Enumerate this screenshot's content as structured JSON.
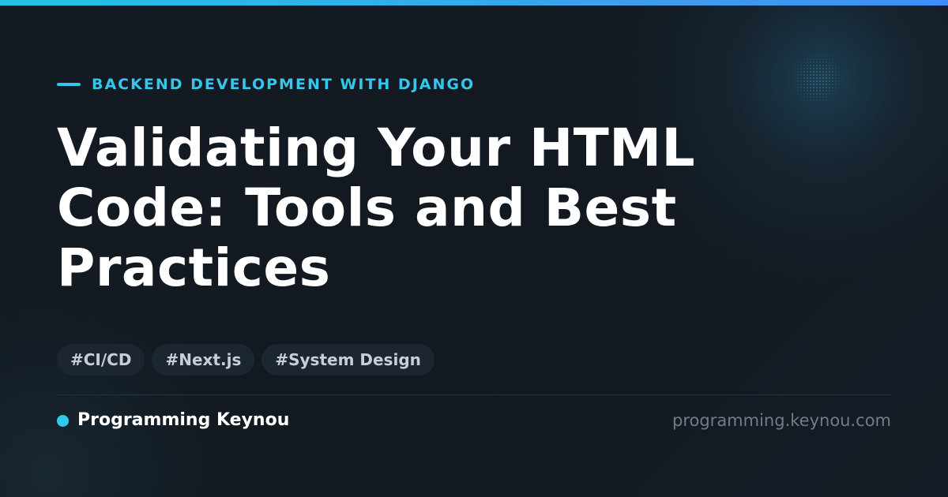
{
  "colors": {
    "background": "#121820",
    "accent": "#35c6ec",
    "title": "#ffffff",
    "tag_background": "#1c2631",
    "tag_text": "#c7ced8",
    "muted": "#6f7d89"
  },
  "eyebrow": {
    "text": "BACKEND DEVELOPMENT WITH DJANGO"
  },
  "title": {
    "line1": "Validating Your HTML",
    "line2": "Code: Tools and Best",
    "line3": "Practices"
  },
  "tags": [
    {
      "label": "#CI/CD"
    },
    {
      "label": "#Next.js"
    },
    {
      "label": "#System Design"
    }
  ],
  "footer": {
    "brand_name": "Programming Keynou",
    "url": "programming.keynou.com"
  }
}
